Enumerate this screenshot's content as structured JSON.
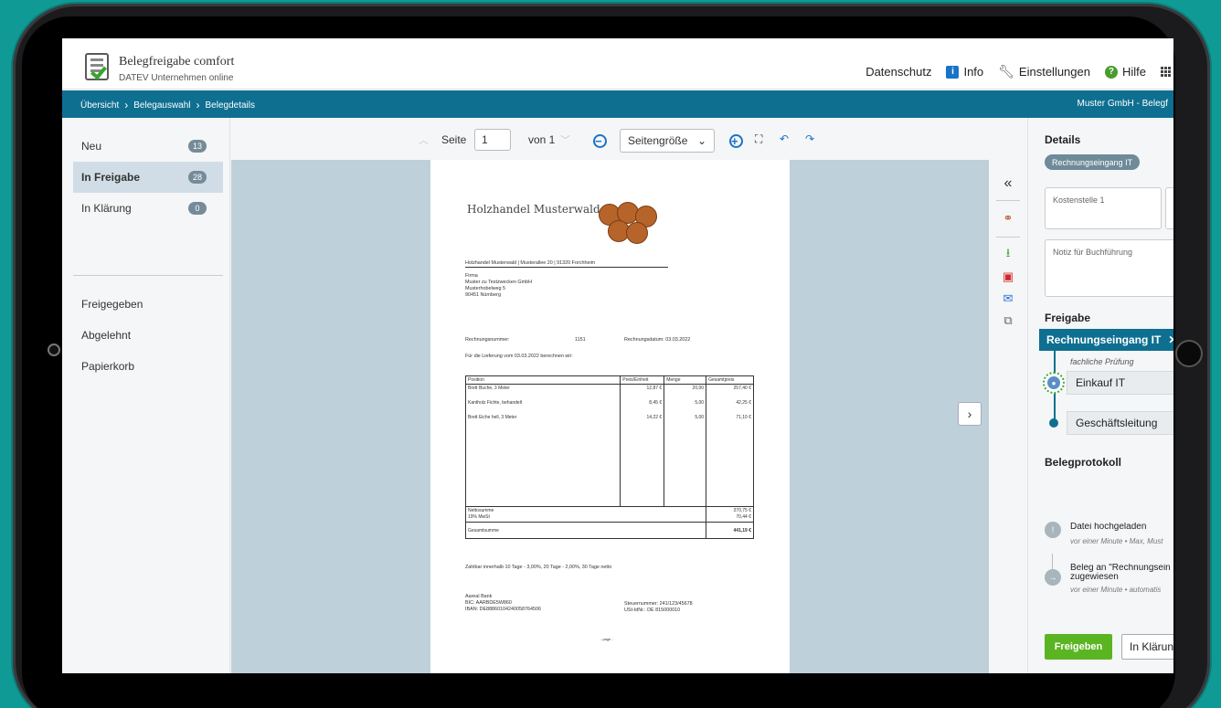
{
  "app": {
    "title": "Belegfreigabe comfort",
    "subtitle": "DATEV Unternehmen online"
  },
  "header_links": {
    "privacy": "Datenschutz",
    "info": "Info",
    "settings": "Einstellungen",
    "help": "Hilfe"
  },
  "breadcrumb": {
    "items": [
      "Übersicht",
      "Belegauswahl",
      "Belegdetails"
    ],
    "right": "Muster GmbH - Belegf"
  },
  "sidebar": {
    "items": [
      {
        "label": "Neu",
        "count": "13"
      },
      {
        "label": "In Freigabe",
        "count": "28"
      },
      {
        "label": "In Klärung",
        "count": "0"
      },
      {
        "label": "Freigegeben"
      },
      {
        "label": "Abgelehnt"
      },
      {
        "label": "Papierkorb"
      }
    ]
  },
  "toolbar": {
    "page_label": "Seite",
    "page_value": "1",
    "of_label": "von 1",
    "zoom_mode": "Seitengröße"
  },
  "invoice": {
    "company": "Holzhandel Musterwald",
    "sender_line": "Holzhandel Musterwald | Musterallee 20 | 91320 Forchheim",
    "address": [
      "Firma",
      "Muster zu Testzwecken GmbH",
      "Musterhobelweg 5",
      "90451 Nürnberg"
    ],
    "number_label": "Rechnungsnummer:",
    "number": "1151",
    "date": "Rechnungsdatum: 03.03.2022",
    "intro": "Für die Lieferung vom 03.03.2022 berechnen wir:",
    "table_headers": [
      "Position",
      "Preis/Einheit",
      "Menge",
      "Gesamtpreis"
    ],
    "rows": [
      [
        "Brett Buche, 3 Meter",
        "12,87 €",
        "20,00",
        "257,40 €"
      ],
      [
        "Kantholz Fichte, behandelt",
        "8,45 €",
        "5,00",
        "42,25 €"
      ],
      [
        "Brett Eiche hell, 3 Meter",
        "14,22 €",
        "5,00",
        "71,10 €"
      ]
    ],
    "net_label": "Nettosumme",
    "vat_label": "19% MwSt",
    "net_value": "370,75 €",
    "vat_value": "70,44 €",
    "total_label": "Gesamtsumme",
    "total_value": "441,19 €",
    "terms": "Zahlbar innerhalb 10 Tage - 3,00%, 20 Tage - 2,00%, 30 Tage netto",
    "bank": [
      "Aareal Bank",
      "BIC: AARBDE5W860",
      "IBAN: DE88860104240058764506"
    ],
    "tax": [
      "Steuernummer: 241/123/45678",
      "USt-IdNr.: DE 815000010"
    ],
    "page_footer": "- page -"
  },
  "right_panel": {
    "details_heading": "Details",
    "tag": "Rechnungseingang IT",
    "cost_center_placeholder": "Kostenstelle 1",
    "note_placeholder": "Notiz für Buchführung",
    "approval_heading": "Freigabe",
    "workflow_chip": "Rechnungseingang IT",
    "workflow_sub": "fachliche Prüfung",
    "steps": [
      "Einkauf IT",
      "Geschäftsleitung"
    ],
    "log_heading": "Belegprotokoll",
    "log": [
      {
        "title": "Datei hochgeladen",
        "meta": "vor einer Minute  •  Max, Must"
      },
      {
        "title": "Beleg an \"Rechnungsein zugewiesen",
        "meta": "vor einer Minute  •  automatis"
      }
    ],
    "approve_button": "Freigeben",
    "clarify_button": "In Klärung"
  }
}
